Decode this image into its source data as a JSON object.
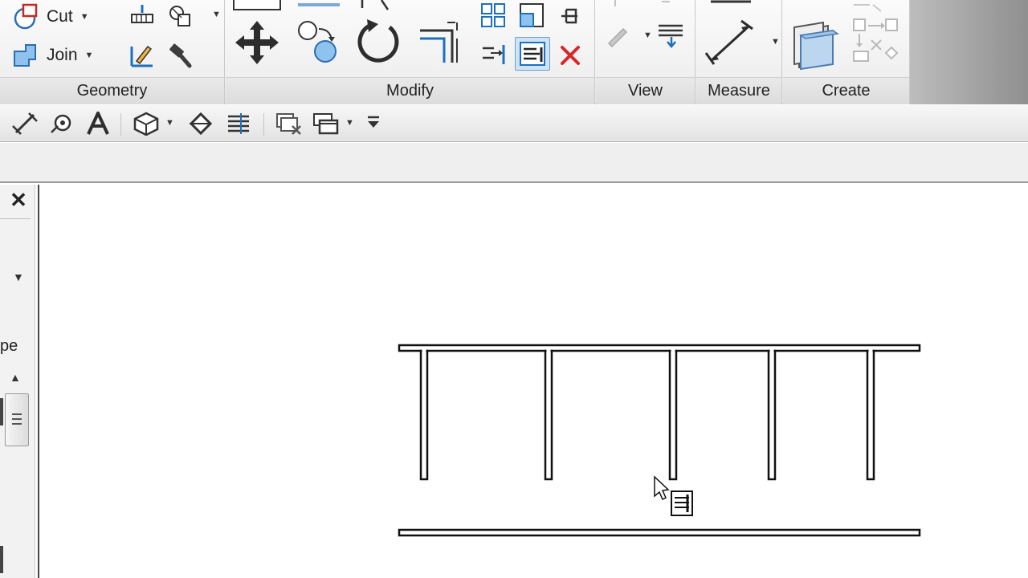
{
  "ribbon": {
    "panels": {
      "geometry": "Geometry",
      "modify": "Modify",
      "view": "View",
      "measure": "Measure",
      "create": "Create"
    },
    "geometry_tools": {
      "cut": "Cut",
      "join": "Join"
    },
    "accent_color": "#1d6fc0",
    "delete_color": "#d9262a"
  },
  "palette": {
    "close_glyph": "✕",
    "label_fragment": "pe"
  }
}
